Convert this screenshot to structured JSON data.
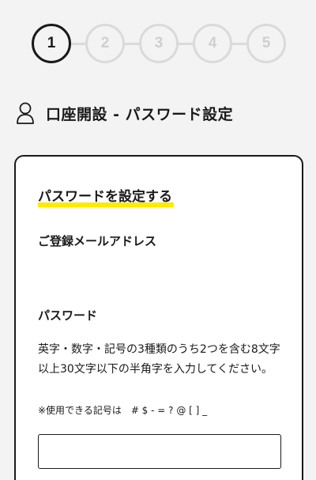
{
  "stepper": {
    "steps": [
      "1",
      "2",
      "3",
      "4",
      "5"
    ],
    "current_step": 1
  },
  "page": {
    "title": "口座開設 - パスワード設定",
    "title_icon": "user-icon"
  },
  "form": {
    "section_heading": "パスワードを設定する",
    "email_label": "ご登録メールアドレス",
    "email_value": "",
    "password_label": "パスワード",
    "password_hint": "英字・数字・記号の3種類のうち2つを含む8文字以上30文字以下の半角字を入力してください。",
    "symbols_note": "※使用できる記号は　# $ - = ? @ [ ] _",
    "password_value": "",
    "password_placeholder": ""
  },
  "colors": {
    "accent_underline": "#ffea00",
    "active_step": "#1a1a1a",
    "inactive_step": "#dadada",
    "background": "#f3f3f3"
  }
}
